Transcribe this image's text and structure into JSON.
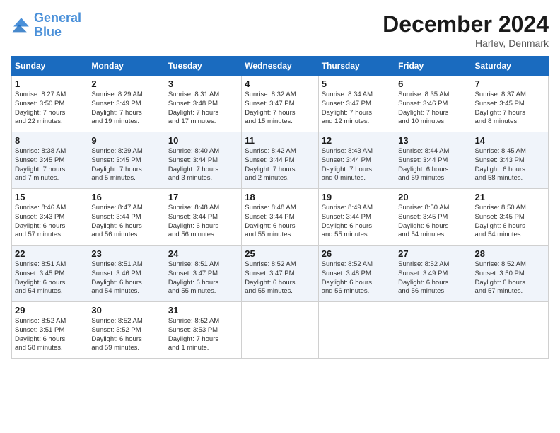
{
  "header": {
    "logo_general": "General",
    "logo_blue": "Blue",
    "month": "December 2024",
    "location": "Harlev, Denmark"
  },
  "days_of_week": [
    "Sunday",
    "Monday",
    "Tuesday",
    "Wednesday",
    "Thursday",
    "Friday",
    "Saturday"
  ],
  "weeks": [
    [
      {
        "day": "1",
        "lines": [
          "Sunrise: 8:27 AM",
          "Sunset: 3:50 PM",
          "Daylight: 7 hours",
          "and 22 minutes."
        ]
      },
      {
        "day": "2",
        "lines": [
          "Sunrise: 8:29 AM",
          "Sunset: 3:49 PM",
          "Daylight: 7 hours",
          "and 19 minutes."
        ]
      },
      {
        "day": "3",
        "lines": [
          "Sunrise: 8:31 AM",
          "Sunset: 3:48 PM",
          "Daylight: 7 hours",
          "and 17 minutes."
        ]
      },
      {
        "day": "4",
        "lines": [
          "Sunrise: 8:32 AM",
          "Sunset: 3:47 PM",
          "Daylight: 7 hours",
          "and 15 minutes."
        ]
      },
      {
        "day": "5",
        "lines": [
          "Sunrise: 8:34 AM",
          "Sunset: 3:47 PM",
          "Daylight: 7 hours",
          "and 12 minutes."
        ]
      },
      {
        "day": "6",
        "lines": [
          "Sunrise: 8:35 AM",
          "Sunset: 3:46 PM",
          "Daylight: 7 hours",
          "and 10 minutes."
        ]
      },
      {
        "day": "7",
        "lines": [
          "Sunrise: 8:37 AM",
          "Sunset: 3:45 PM",
          "Daylight: 7 hours",
          "and 8 minutes."
        ]
      }
    ],
    [
      {
        "day": "8",
        "lines": [
          "Sunrise: 8:38 AM",
          "Sunset: 3:45 PM",
          "Daylight: 7 hours",
          "and 7 minutes."
        ]
      },
      {
        "day": "9",
        "lines": [
          "Sunrise: 8:39 AM",
          "Sunset: 3:45 PM",
          "Daylight: 7 hours",
          "and 5 minutes."
        ]
      },
      {
        "day": "10",
        "lines": [
          "Sunrise: 8:40 AM",
          "Sunset: 3:44 PM",
          "Daylight: 7 hours",
          "and 3 minutes."
        ]
      },
      {
        "day": "11",
        "lines": [
          "Sunrise: 8:42 AM",
          "Sunset: 3:44 PM",
          "Daylight: 7 hours",
          "and 2 minutes."
        ]
      },
      {
        "day": "12",
        "lines": [
          "Sunrise: 8:43 AM",
          "Sunset: 3:44 PM",
          "Daylight: 7 hours",
          "and 0 minutes."
        ]
      },
      {
        "day": "13",
        "lines": [
          "Sunrise: 8:44 AM",
          "Sunset: 3:44 PM",
          "Daylight: 6 hours",
          "and 59 minutes."
        ]
      },
      {
        "day": "14",
        "lines": [
          "Sunrise: 8:45 AM",
          "Sunset: 3:43 PM",
          "Daylight: 6 hours",
          "and 58 minutes."
        ]
      }
    ],
    [
      {
        "day": "15",
        "lines": [
          "Sunrise: 8:46 AM",
          "Sunset: 3:43 PM",
          "Daylight: 6 hours",
          "and 57 minutes."
        ]
      },
      {
        "day": "16",
        "lines": [
          "Sunrise: 8:47 AM",
          "Sunset: 3:44 PM",
          "Daylight: 6 hours",
          "and 56 minutes."
        ]
      },
      {
        "day": "17",
        "lines": [
          "Sunrise: 8:48 AM",
          "Sunset: 3:44 PM",
          "Daylight: 6 hours",
          "and 56 minutes."
        ]
      },
      {
        "day": "18",
        "lines": [
          "Sunrise: 8:48 AM",
          "Sunset: 3:44 PM",
          "Daylight: 6 hours",
          "and 55 minutes."
        ]
      },
      {
        "day": "19",
        "lines": [
          "Sunrise: 8:49 AM",
          "Sunset: 3:44 PM",
          "Daylight: 6 hours",
          "and 55 minutes."
        ]
      },
      {
        "day": "20",
        "lines": [
          "Sunrise: 8:50 AM",
          "Sunset: 3:45 PM",
          "Daylight: 6 hours",
          "and 54 minutes."
        ]
      },
      {
        "day": "21",
        "lines": [
          "Sunrise: 8:50 AM",
          "Sunset: 3:45 PM",
          "Daylight: 6 hours",
          "and 54 minutes."
        ]
      }
    ],
    [
      {
        "day": "22",
        "lines": [
          "Sunrise: 8:51 AM",
          "Sunset: 3:45 PM",
          "Daylight: 6 hours",
          "and 54 minutes."
        ]
      },
      {
        "day": "23",
        "lines": [
          "Sunrise: 8:51 AM",
          "Sunset: 3:46 PM",
          "Daylight: 6 hours",
          "and 54 minutes."
        ]
      },
      {
        "day": "24",
        "lines": [
          "Sunrise: 8:51 AM",
          "Sunset: 3:47 PM",
          "Daylight: 6 hours",
          "and 55 minutes."
        ]
      },
      {
        "day": "25",
        "lines": [
          "Sunrise: 8:52 AM",
          "Sunset: 3:47 PM",
          "Daylight: 6 hours",
          "and 55 minutes."
        ]
      },
      {
        "day": "26",
        "lines": [
          "Sunrise: 8:52 AM",
          "Sunset: 3:48 PM",
          "Daylight: 6 hours",
          "and 56 minutes."
        ]
      },
      {
        "day": "27",
        "lines": [
          "Sunrise: 8:52 AM",
          "Sunset: 3:49 PM",
          "Daylight: 6 hours",
          "and 56 minutes."
        ]
      },
      {
        "day": "28",
        "lines": [
          "Sunrise: 8:52 AM",
          "Sunset: 3:50 PM",
          "Daylight: 6 hours",
          "and 57 minutes."
        ]
      }
    ],
    [
      {
        "day": "29",
        "lines": [
          "Sunrise: 8:52 AM",
          "Sunset: 3:51 PM",
          "Daylight: 6 hours",
          "and 58 minutes."
        ]
      },
      {
        "day": "30",
        "lines": [
          "Sunrise: 8:52 AM",
          "Sunset: 3:52 PM",
          "Daylight: 6 hours",
          "and 59 minutes."
        ]
      },
      {
        "day": "31",
        "lines": [
          "Sunrise: 8:52 AM",
          "Sunset: 3:53 PM",
          "Daylight: 7 hours",
          "and 1 minute."
        ]
      },
      {
        "day": "",
        "lines": []
      },
      {
        "day": "",
        "lines": []
      },
      {
        "day": "",
        "lines": []
      },
      {
        "day": "",
        "lines": []
      }
    ]
  ]
}
